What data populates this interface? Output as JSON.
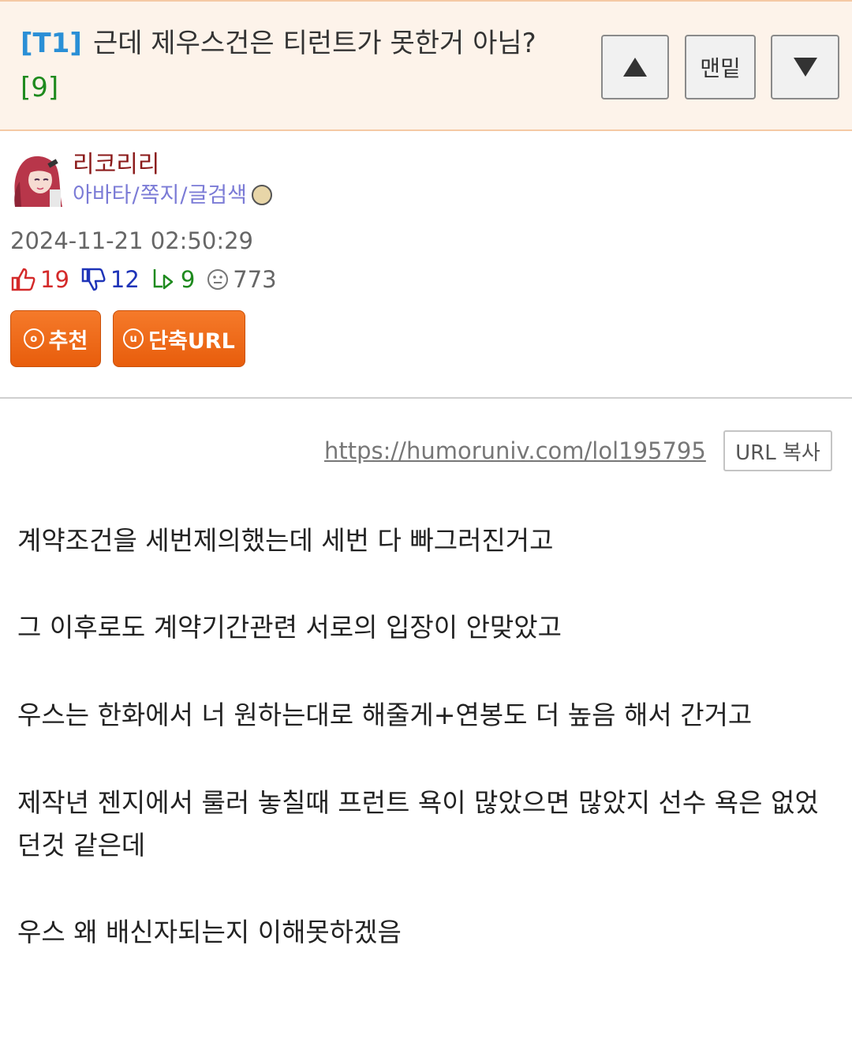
{
  "header": {
    "category": "[T1]",
    "title": "근데 제우스건은 티런트가 못한거 아님?",
    "reply_count": "[9]",
    "nav": {
      "up_icon": "triangle-up-icon",
      "bottom_label": "맨밑",
      "down_icon": "triangle-down-icon"
    }
  },
  "author": {
    "name": "리코리리",
    "links": [
      "아바타",
      "쪽지",
      "글검색"
    ],
    "link_separator": "/",
    "badge_icon": "medal-icon"
  },
  "post": {
    "timestamp": "2024-11-21 02:50:29",
    "stats": {
      "up": "19",
      "down": "12",
      "replies": "9",
      "views": "773"
    }
  },
  "actions": {
    "recommend_label": "추천",
    "short_url_label": "단축URL"
  },
  "url": {
    "link": "https://humoruniv.com/lol195795",
    "copy_label": "URL 복사"
  },
  "body": {
    "paragraphs": [
      "계약조건을 세번제의했는데 세번 다 빠그러진거고",
      "그 이후로도 계약기간관련 서로의 입장이 안맞았고",
      "우스는 한화에서 너 원하는대로 해줄게+연봉도 더 높음 해서 간거고",
      "제작년 젠지에서 룰러 놓칠때 프런트 욕이 많았으면 많았지 선수 욕은 없었던것 같은데",
      "우스 왜 배신자되는지 이해못하겠음"
    ]
  },
  "colors": {
    "header_bg": "#fdf3ea",
    "category": "#2a8fd6",
    "reply_count": "#1e8a1e",
    "author_name": "#8b1a1a",
    "author_links": "#7b7bd6",
    "up": "#d42a2a",
    "down": "#1f34b8",
    "action_button": "#f06a1a"
  }
}
